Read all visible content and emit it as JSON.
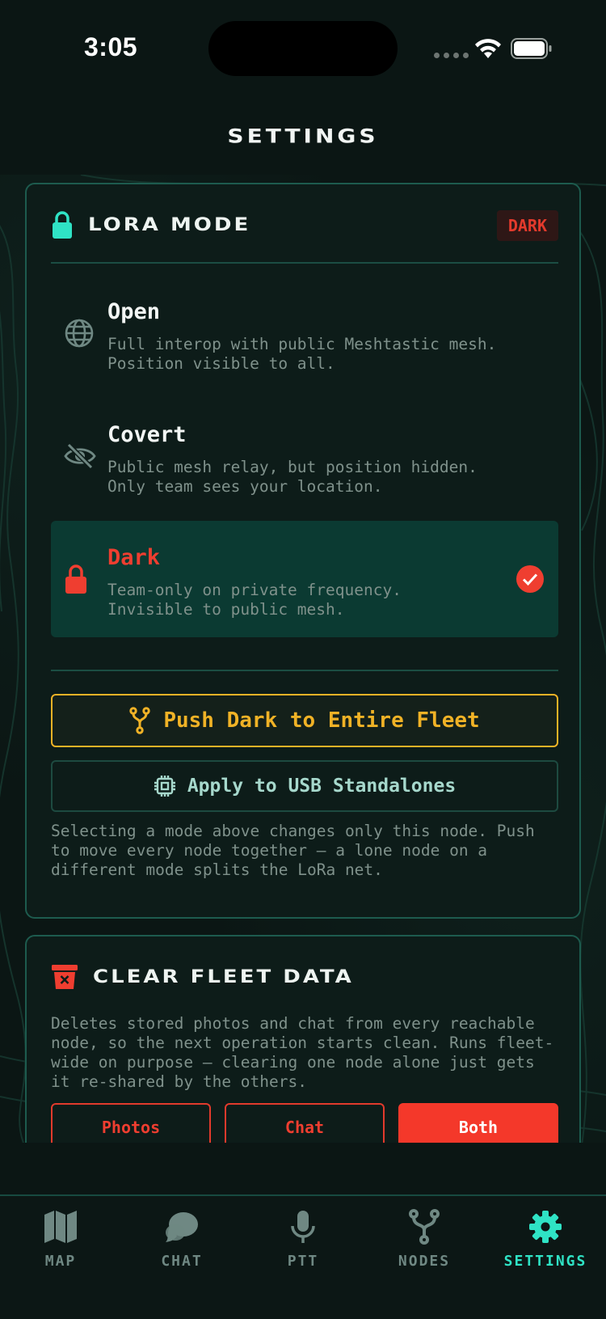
{
  "status_bar": {
    "time": "3:05"
  },
  "header": {
    "title": "SETTINGS"
  },
  "lora_card": {
    "title": "LORA MODE",
    "current_badge": "DARK",
    "options": [
      {
        "title": "Open",
        "description": "Full interop with public Meshtastic mesh.\nPosition visible to all.",
        "icon": "globe-icon",
        "selected": false
      },
      {
        "title": "Covert",
        "description": "Public mesh relay, but position hidden.\nOnly team sees your location.",
        "icon": "eye-slash-icon",
        "selected": false
      },
      {
        "title": "Dark",
        "description": "Team-only on private frequency.\nInvisible to public mesh.",
        "icon": "lock-icon",
        "selected": true
      }
    ],
    "push_button": "Push Dark to Entire Fleet",
    "usb_button": "Apply to USB Standalones",
    "note": "Selecting a mode above changes only this node. Push to move every node together — a lone node on a different mode splits the LoRa net."
  },
  "clear_card": {
    "title": "CLEAR FLEET DATA",
    "description": "Deletes stored photos and chat from every reachable node, so the next operation starts clean. Runs fleet-wide on purpose — clearing one node alone just gets it re-shared by the others.",
    "buttons": [
      "Photos",
      "Chat",
      "Both"
    ]
  },
  "tabs": [
    {
      "label": "MAP",
      "icon": "map-icon",
      "active": false
    },
    {
      "label": "CHAT",
      "icon": "chat-bubble-icon",
      "active": false
    },
    {
      "label": "PTT",
      "icon": "microphone-icon",
      "active": false
    },
    {
      "label": "NODES",
      "icon": "nodes-fork-icon",
      "active": false
    },
    {
      "label": "SETTINGS",
      "icon": "gear-icon",
      "active": true
    }
  ],
  "colors": {
    "accent_teal": "#2fe3c5",
    "danger_red": "#ef3e30",
    "warning_amber": "#f0b226",
    "background": "#0b1614",
    "card_border": "#1d5b4e"
  }
}
